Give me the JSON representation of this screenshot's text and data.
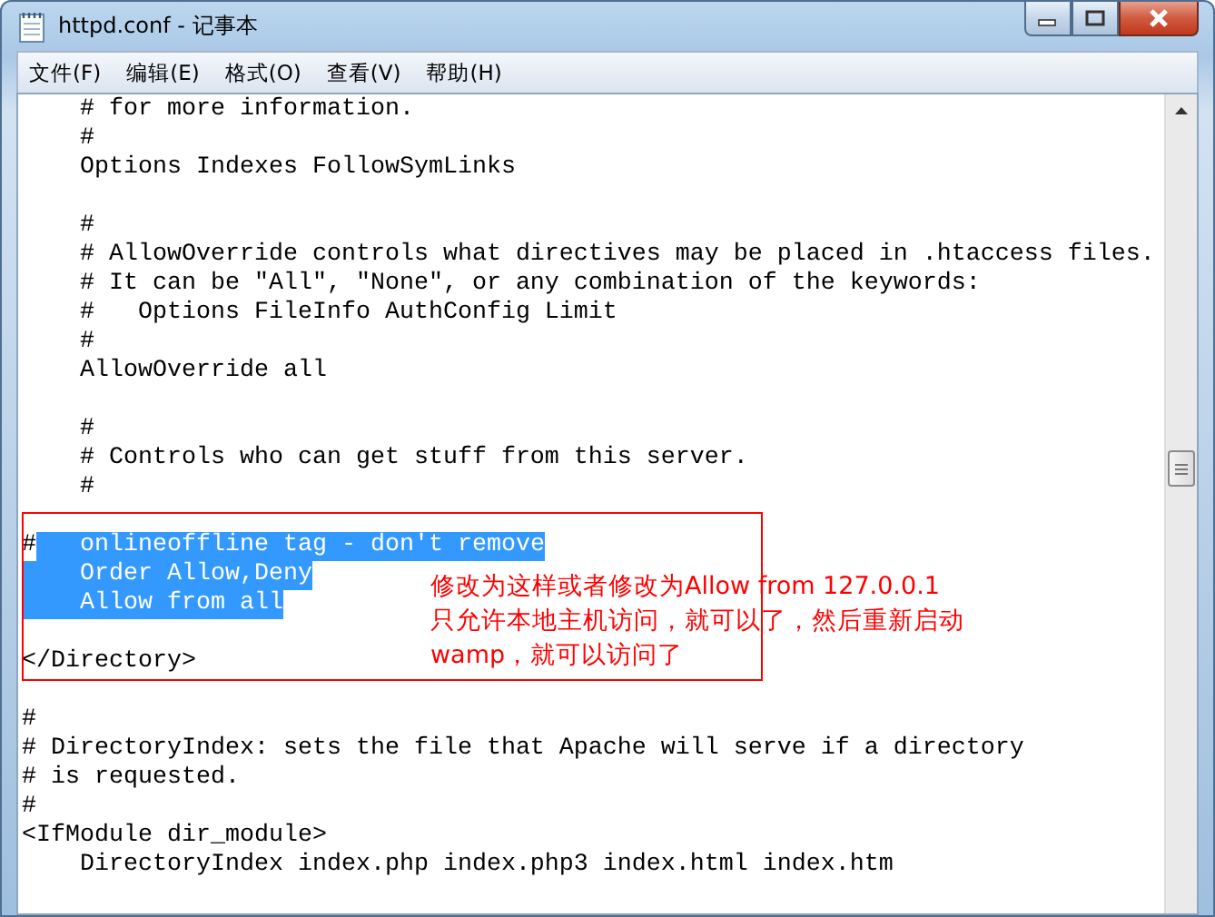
{
  "window": {
    "title": "httpd.conf - 记事本"
  },
  "menu": [
    "文件(F)",
    "编辑(E)",
    "格式(O)",
    "查看(V)",
    "帮助(H)"
  ],
  "editor": {
    "lines": [
      {
        "kind": "text",
        "text": "    # for more information."
      },
      {
        "kind": "text",
        "text": "    #"
      },
      {
        "kind": "text",
        "text": "    Options Indexes FollowSymLinks"
      },
      {
        "kind": "blank"
      },
      {
        "kind": "text",
        "text": "    #"
      },
      {
        "kind": "text",
        "text": "    # AllowOverride controls what directives may be placed in .htaccess files."
      },
      {
        "kind": "text",
        "text": "    # It can be \"All\", \"None\", or any combination of the keywords:"
      },
      {
        "kind": "text",
        "text": "    #   Options FileInfo AuthConfig Limit"
      },
      {
        "kind": "text",
        "text": "    #"
      },
      {
        "kind": "text",
        "text": "    AllowOverride all"
      },
      {
        "kind": "blank"
      },
      {
        "kind": "text",
        "text": "    #"
      },
      {
        "kind": "text",
        "text": "    # Controls who can get stuff from this server."
      },
      {
        "kind": "text",
        "text": "    #"
      },
      {
        "kind": "blank"
      },
      {
        "kind": "text",
        "text": "#",
        "selected_text": "   onlineoffline tag - don't remove"
      },
      {
        "kind": "text",
        "selected_text": "    Order Allow,Deny"
      },
      {
        "kind": "text",
        "selected_text": "    Allow from all"
      },
      {
        "kind": "blank"
      },
      {
        "kind": "text",
        "text": "</Directory>"
      },
      {
        "kind": "blank"
      },
      {
        "kind": "text",
        "text": "#"
      },
      {
        "kind": "text",
        "text": "# DirectoryIndex: sets the file that Apache will serve if a directory"
      },
      {
        "kind": "text",
        "text": "# is requested."
      },
      {
        "kind": "text",
        "text": "#"
      },
      {
        "kind": "text",
        "text": "<IfModule dir_module>"
      },
      {
        "kind": "text",
        "text": "    DirectoryIndex index.php index.php3 index.html index.htm"
      }
    ]
  },
  "annotation": {
    "lines": [
      "修改为这样或者修改为Allow from 127.0.0.1",
      "只允许本地主机访问，就可以了，然后重新启动",
      "wamp，就可以访问了"
    ]
  }
}
